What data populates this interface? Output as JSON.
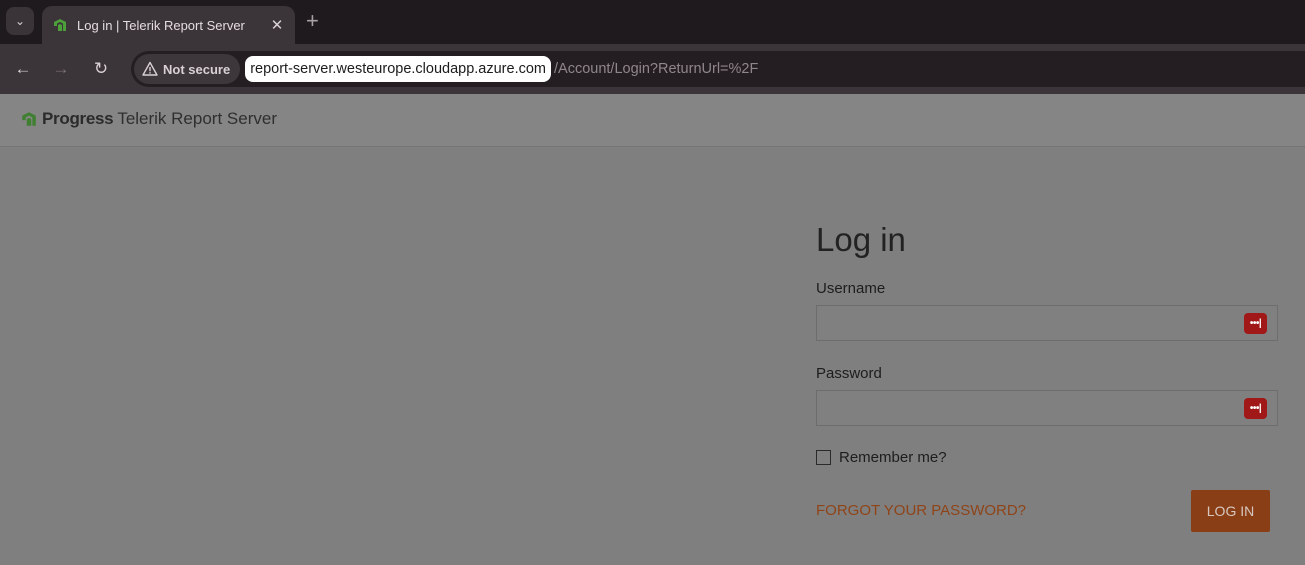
{
  "browser": {
    "tab_title": "Log in | Telerik Report Server",
    "tab_close": "✕",
    "new_tab": "+",
    "security_label": "Not secure",
    "url_host": "report-server.westeurope.cloudapp.azure.com",
    "url_path": "/Account/Login?ReturnUrl=%2F"
  },
  "header": {
    "brand_progress": "Progress",
    "brand_product": "Telerik Report Server"
  },
  "login": {
    "title": "Log in",
    "username_label": "Username",
    "username_value": "",
    "password_label": "Password",
    "password_value": "",
    "password_manager_badge": "•••|",
    "remember_label": "Remember me?",
    "remember_checked": false,
    "forgot_link": "FORGOT YOUR PASSWORD?",
    "submit_label": "LOG IN"
  },
  "colors": {
    "accent": "#8a3e16",
    "brand_green": "#4ca03a",
    "badge_red": "#a01818"
  }
}
